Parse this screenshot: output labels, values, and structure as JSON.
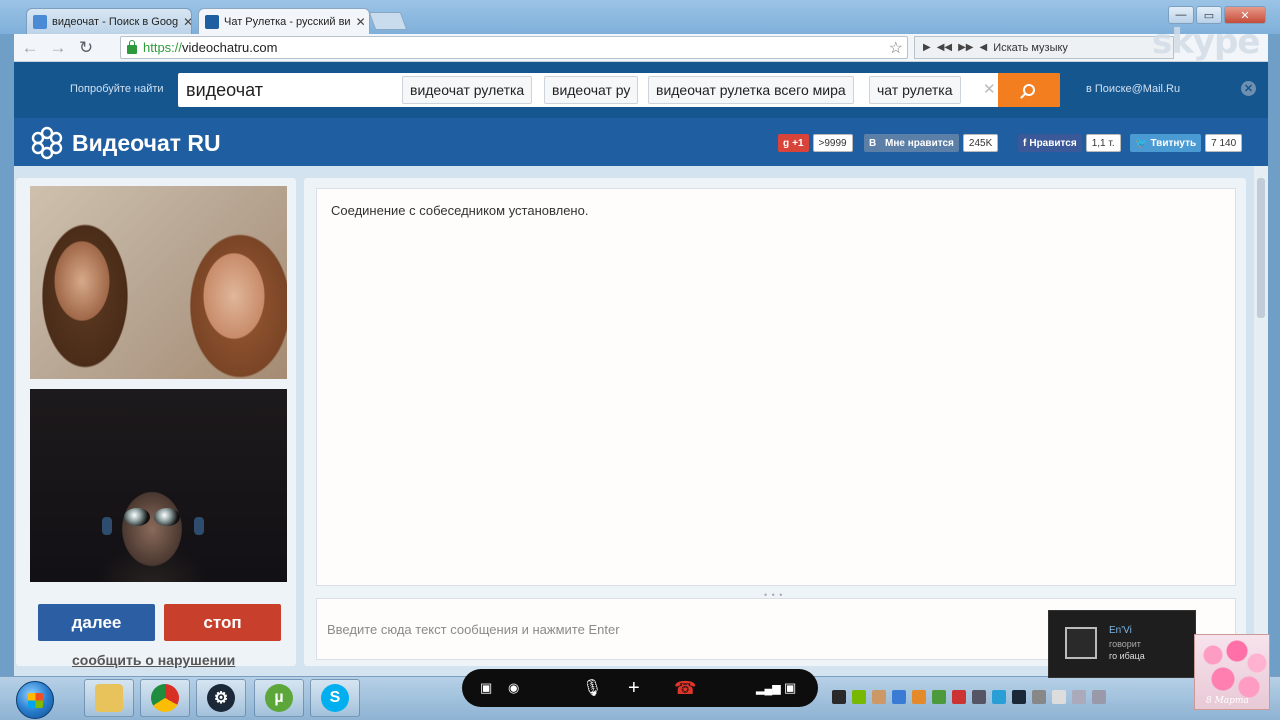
{
  "browser": {
    "tabs": [
      {
        "label": "видеочат - Поиск в Goog",
        "active": false
      },
      {
        "label": "Чат Рулетка - русский ви",
        "active": true
      }
    ],
    "url": {
      "protocol": "https://",
      "host": "videochatru.com"
    },
    "music_placeholder": "Искать музыку"
  },
  "watermark": "skype",
  "mailbar": {
    "try_label": "Попробуйте найти",
    "query": "видеочат",
    "suggestions": [
      "видеочат рулетка",
      "видеочат ру",
      "видеочат рулетка всего мира",
      "чат рулетка"
    ],
    "brand": "в Поиске@Mail.Ru"
  },
  "site": {
    "title": "Видеочат RU",
    "social": {
      "gplus": {
        "label": "+1",
        "count": ">9999"
      },
      "vk": {
        "label": "Мне нравится",
        "count": "245K"
      },
      "fb": {
        "label": "Нравится",
        "count": "1,1 т."
      },
      "twitter": {
        "label": "Твитнуть",
        "count": "7 140"
      }
    }
  },
  "video": {
    "next_button": "далее",
    "stop_button": "стоп",
    "report_link": "сообщить о нарушении"
  },
  "chat": {
    "status": "Соединение с собеседником установлено.",
    "input_placeholder": "Введите сюда текст сообщения и нажмите Enter"
  },
  "notification": {
    "name": "En'Vi",
    "verb": "говорит",
    "message": "го ибаца"
  },
  "wallpaper_text": "8 Марта",
  "colors": {
    "mail_blue": "#16568f",
    "site_blue": "#1f5ea0",
    "next_button": "#2c5ea3",
    "stop_button": "#c8402b",
    "search_orange": "#f37e1f"
  }
}
